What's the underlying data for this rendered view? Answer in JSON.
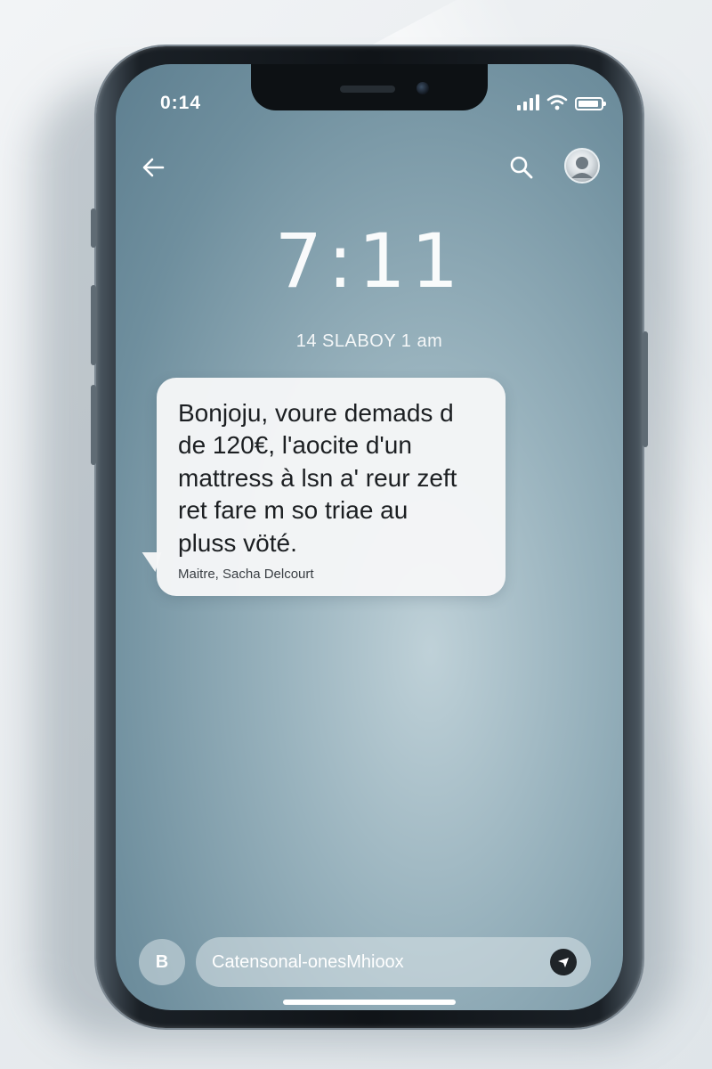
{
  "status_bar": {
    "time": "0:14"
  },
  "lock": {
    "clock": "7:11",
    "date_line": "14 SLABOY 1 am"
  },
  "message": {
    "text": "Bonjoju, voure demads d\nde 120€, l'aocite d'un\nmattress à lsn a' reur zeft\nret fare m so triae au\npluss vöté.",
    "sender": "Maitre, Sacha Delcourt"
  },
  "compose": {
    "attach_label": "B",
    "placeholder": "Catensonal-onesMhioox"
  },
  "icons": {
    "back": "back-arrow-icon",
    "search": "search-icon",
    "avatar": "avatar",
    "signal": "signal-icon",
    "wifi": "wifi-icon",
    "battery": "battery-icon",
    "send": "send-icon"
  },
  "colors": {
    "screen_bg": "#7f9ead",
    "bubble_bg": "#f5f6f7",
    "text_dark": "#1c1f22"
  }
}
